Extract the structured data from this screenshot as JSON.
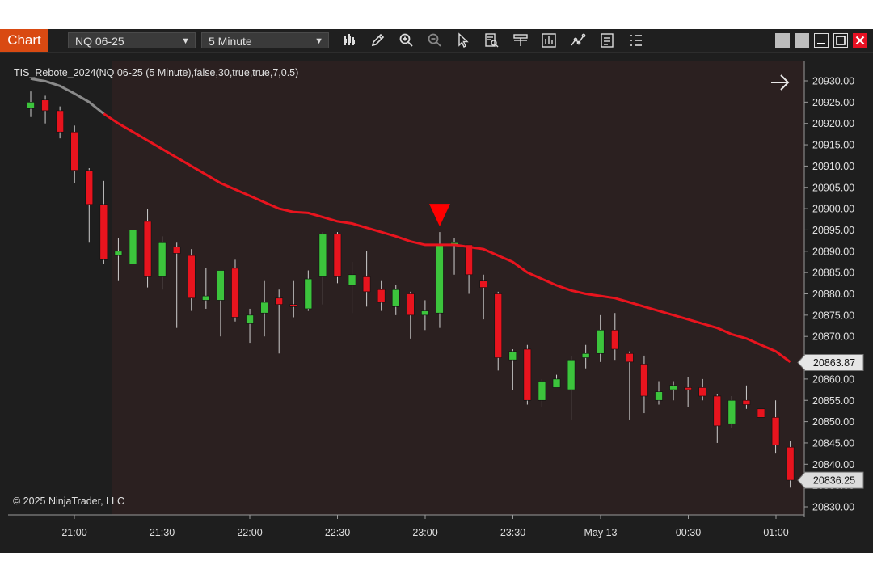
{
  "toolbar": {
    "chart_tab": "Chart",
    "instrument": "NQ 06-25",
    "timeframe": "5 Minute"
  },
  "chart": {
    "indicator_label": "TIS_Rebote_2024(NQ 06-25 (5 Minute),false,30,true,true,7,0.5)",
    "copyright": "© 2025 NinjaTrader, LLC",
    "price_markers": [
      "20863.87",
      "20836.25"
    ],
    "colors": {
      "up": "#3cc43c",
      "down": "#e8141e",
      "ma": "#e8141e",
      "bg": "#2b2020"
    }
  },
  "chart_data": {
    "type": "candlestick",
    "x_ticks": [
      "21:00",
      "21:30",
      "22:00",
      "22:30",
      "23:00",
      "23:30",
      "May 13",
      "00:30",
      "01:00"
    ],
    "y_ticks": [
      "20830.00",
      "20835.00",
      "20840.00",
      "20845.00",
      "20850.00",
      "20855.00",
      "20860.00",
      "20865.00",
      "20870.00",
      "20875.00",
      "20880.00",
      "20885.00",
      "20890.00",
      "20895.00",
      "20900.00",
      "20905.00",
      "20910.00",
      "20915.00",
      "20920.00",
      "20925.00",
      "20930.00"
    ],
    "ylim": [
      20828,
      20932
    ],
    "candles": [
      {
        "o": 20923.5,
        "h": 20927.5,
        "l": 20921.5,
        "c": 20925.0
      },
      {
        "o": 20925.5,
        "h": 20926.5,
        "l": 20920.0,
        "c": 20923.0
      },
      {
        "o": 20923.0,
        "h": 20924.0,
        "l": 20916.5,
        "c": 20918.0
      },
      {
        "o": 20918.0,
        "h": 20919.5,
        "l": 20906.0,
        "c": 20909.0
      },
      {
        "o": 20909.0,
        "h": 20909.5,
        "l": 20892.0,
        "c": 20901.0
      },
      {
        "o": 20901.0,
        "h": 20906.5,
        "l": 20887.0,
        "c": 20888.0
      },
      {
        "o": 20889.0,
        "h": 20893.0,
        "l": 20883.0,
        "c": 20890.0
      },
      {
        "o": 20887.0,
        "h": 20899.5,
        "l": 20883.0,
        "c": 20895.0
      },
      {
        "o": 20897.0,
        "h": 20900.0,
        "l": 20881.5,
        "c": 20884.0
      },
      {
        "o": 20884.0,
        "h": 20893.5,
        "l": 20881.0,
        "c": 20892.0
      },
      {
        "o": 20891.0,
        "h": 20892.0,
        "l": 20872.0,
        "c": 20889.5
      },
      {
        "o": 20889.0,
        "h": 20890.5,
        "l": 20876.0,
        "c": 20879.0
      },
      {
        "o": 20878.5,
        "h": 20886.0,
        "l": 20876.5,
        "c": 20879.5
      },
      {
        "o": 20878.5,
        "h": 20885.5,
        "l": 20870.0,
        "c": 20885.5
      },
      {
        "o": 20886.0,
        "h": 20888.0,
        "l": 20873.5,
        "c": 20874.5
      },
      {
        "o": 20873.0,
        "h": 20876.5,
        "l": 20868.5,
        "c": 20875.0
      },
      {
        "o": 20875.5,
        "h": 20883.0,
        "l": 20870.0,
        "c": 20878.0
      },
      {
        "o": 20879.0,
        "h": 20881.0,
        "l": 20866.0,
        "c": 20877.5
      },
      {
        "o": 20877.5,
        "h": 20883.0,
        "l": 20874.5,
        "c": 20877.0
      },
      {
        "o": 20876.5,
        "h": 20885.5,
        "l": 20876.0,
        "c": 20883.5
      },
      {
        "o": 20884.0,
        "h": 20894.5,
        "l": 20877.5,
        "c": 20894.0
      },
      {
        "o": 20894.0,
        "h": 20894.5,
        "l": 20882.5,
        "c": 20884.0
      },
      {
        "o": 20882.0,
        "h": 20887.5,
        "l": 20875.5,
        "c": 20884.5
      },
      {
        "o": 20884.0,
        "h": 20890.0,
        "l": 20877.0,
        "c": 20880.5
      },
      {
        "o": 20881.0,
        "h": 20883.0,
        "l": 20876.0,
        "c": 20878.0
      },
      {
        "o": 20877.0,
        "h": 20882.0,
        "l": 20875.0,
        "c": 20881.0
      },
      {
        "o": 20880.0,
        "h": 20880.5,
        "l": 20869.5,
        "c": 20875.0
      },
      {
        "o": 20875.0,
        "h": 20878.5,
        "l": 20871.5,
        "c": 20876.0
      },
      {
        "o": 20875.5,
        "h": 20894.5,
        "l": 20872.0,
        "c": 20891.5
      },
      {
        "o": 20892.0,
        "h": 20893.0,
        "l": 20884.5,
        "c": 20892.0
      },
      {
        "o": 20891.5,
        "h": 20891.5,
        "l": 20880.0,
        "c": 20884.5
      },
      {
        "o": 20883.0,
        "h": 20884.5,
        "l": 20874.0,
        "c": 20881.5
      },
      {
        "o": 20880.0,
        "h": 20880.5,
        "l": 20862.0,
        "c": 20865.0
      },
      {
        "o": 20864.5,
        "h": 20867.0,
        "l": 20857.5,
        "c": 20866.5
      },
      {
        "o": 20867.0,
        "h": 20868.0,
        "l": 20854.0,
        "c": 20855.0
      },
      {
        "o": 20855.0,
        "h": 20860.0,
        "l": 20853.5,
        "c": 20859.5
      },
      {
        "o": 20858.0,
        "h": 20861.0,
        "l": 20858.0,
        "c": 20860.0
      },
      {
        "o": 20857.5,
        "h": 20865.5,
        "l": 20850.5,
        "c": 20864.5
      },
      {
        "o": 20865.0,
        "h": 20868.0,
        "l": 20862.5,
        "c": 20866.0
      },
      {
        "o": 20866.0,
        "h": 20875.0,
        "l": 20864.0,
        "c": 20871.5
      },
      {
        "o": 20871.5,
        "h": 20875.5,
        "l": 20864.5,
        "c": 20867.0
      },
      {
        "o": 20866.0,
        "h": 20866.5,
        "l": 20850.5,
        "c": 20864.0
      },
      {
        "o": 20863.5,
        "h": 20865.5,
        "l": 20852.0,
        "c": 20856.0
      },
      {
        "o": 20855.0,
        "h": 20859.5,
        "l": 20854.0,
        "c": 20857.0
      },
      {
        "o": 20857.5,
        "h": 20859.5,
        "l": 20855.0,
        "c": 20858.5
      },
      {
        "o": 20858.0,
        "h": 20860.5,
        "l": 20853.5,
        "c": 20857.5
      },
      {
        "o": 20858.0,
        "h": 20860.0,
        "l": 20855.0,
        "c": 20856.0
      },
      {
        "o": 20856.0,
        "h": 20856.5,
        "l": 20845.0,
        "c": 20849.0
      },
      {
        "o": 20849.5,
        "h": 20856.0,
        "l": 20848.5,
        "c": 20855.0
      },
      {
        "o": 20855.0,
        "h": 20858.5,
        "l": 20853.0,
        "c": 20854.0
      },
      {
        "o": 20853.0,
        "h": 20854.5,
        "l": 20849.0,
        "c": 20851.0
      },
      {
        "o": 20851.0,
        "h": 20855.0,
        "l": 20842.5,
        "c": 20844.5
      },
      {
        "o": 20844.0,
        "h": 20845.5,
        "l": 20834.5,
        "c": 20836.25
      }
    ],
    "ma": [
      20930.5,
      20929.9,
      20928.8,
      20927.0,
      20925.0,
      20922.3,
      20920.0,
      20918.0,
      20916.0,
      20914.0,
      20912.0,
      20910.0,
      20908.0,
      20906.0,
      20904.5,
      20903.0,
      20901.5,
      20900.0,
      20899.2,
      20899.0,
      20898.0,
      20897.0,
      20896.5,
      20895.5,
      20894.5,
      20893.5,
      20892.3,
      20891.5,
      20891.5,
      20891.5,
      20891.0,
      20890.5,
      20889.0,
      20887.5,
      20885.0,
      20883.5,
      20882.0,
      20880.8,
      20880.0,
      20879.5,
      20879.0,
      20878.0,
      20877.0,
      20876.0,
      20875.0,
      20874.0,
      20873.0,
      20872.0,
      20870.5,
      20869.5,
      20868.0,
      20866.5,
      20864.0
    ],
    "sell_signal_index": 28,
    "shaded_until_index": 5
  }
}
